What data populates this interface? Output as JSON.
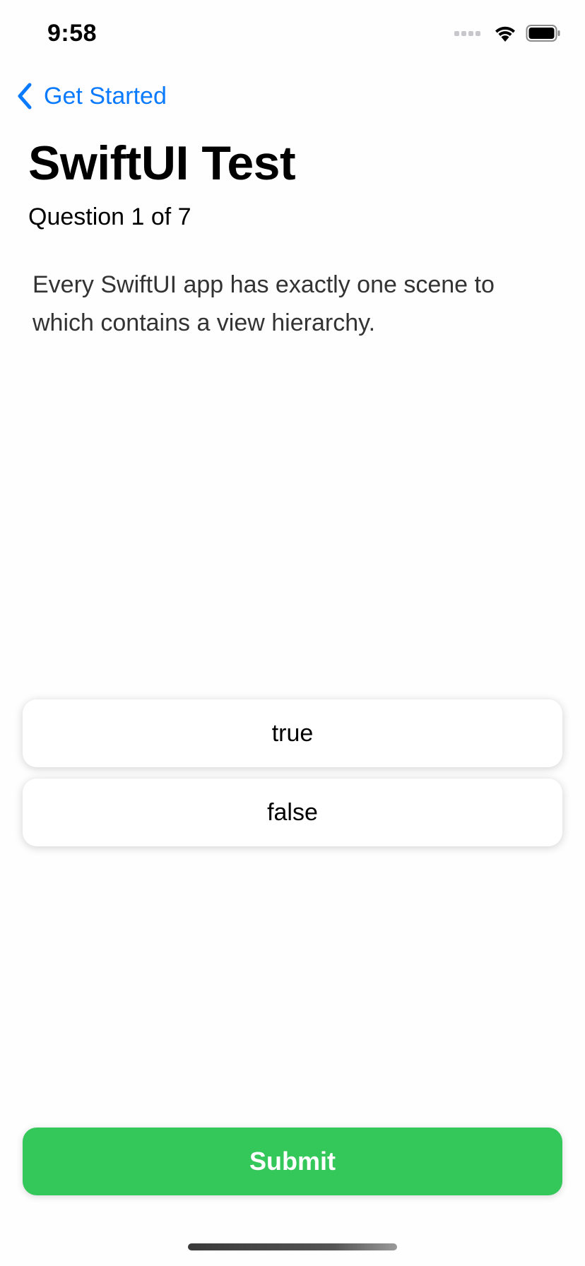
{
  "status_bar": {
    "time": "9:58",
    "icons": [
      "cellular-signal-icon",
      "wifi-icon",
      "battery-icon"
    ]
  },
  "nav": {
    "back_label": "Get Started",
    "back_icon": "chevron-left-icon"
  },
  "header": {
    "title": "SwiftUI Test",
    "question_count": "Question 1 of 7"
  },
  "question": {
    "text": "Every SwiftUI app has exactly one scene to which contains a view hierarchy."
  },
  "answers": [
    {
      "label": "true"
    },
    {
      "label": "false"
    }
  ],
  "submit": {
    "label": "Submit"
  },
  "colors": {
    "accent": "#0a7aff",
    "submit_bg": "#34c759",
    "background": "#fefefe"
  }
}
